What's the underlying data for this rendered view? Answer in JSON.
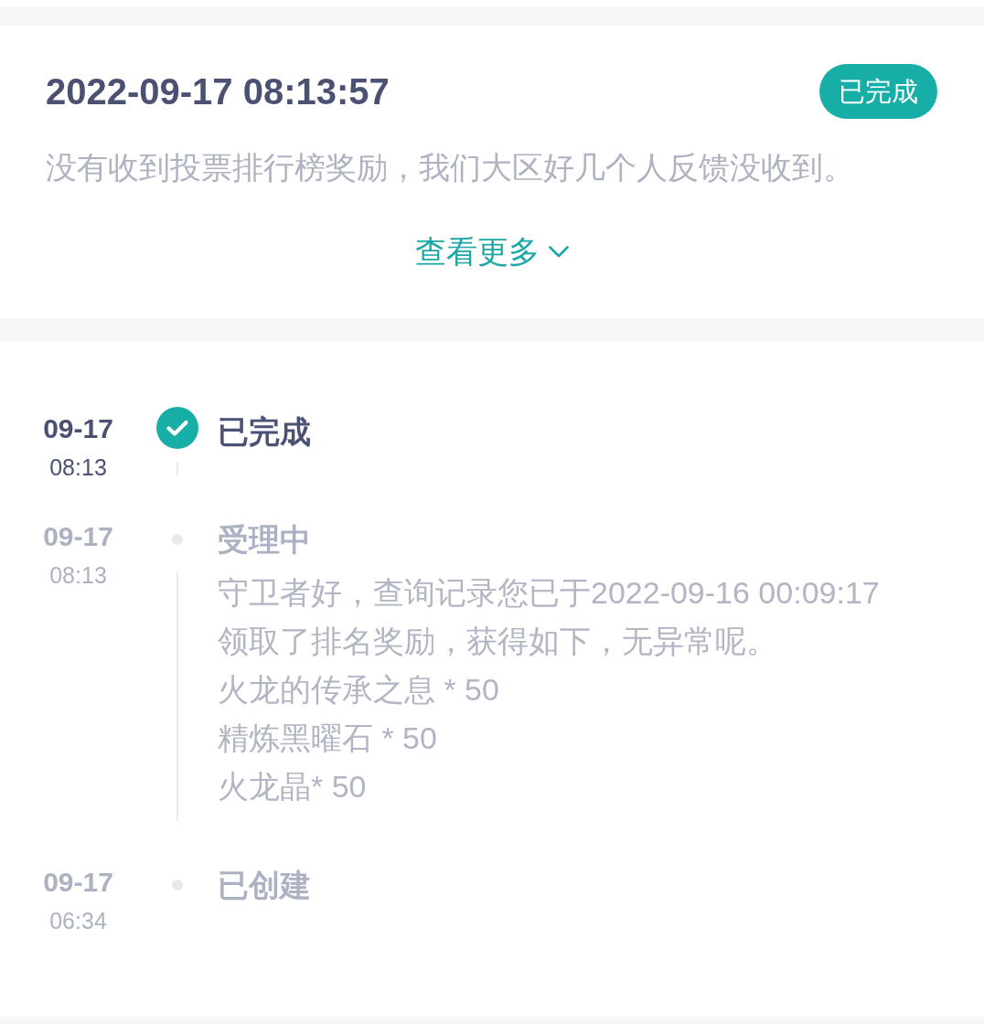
{
  "ticket": {
    "time": "2022-09-17 08:13:57",
    "status": "已完成",
    "description": "没有收到投票排行榜奖励，我们大区好几个人反馈没收到。",
    "more_link": "查看更多"
  },
  "timeline": [
    {
      "date": "09-17",
      "time": "08:13",
      "title": "已完成",
      "active": true
    },
    {
      "date": "09-17",
      "time": "08:13",
      "title": "受理中",
      "active": false,
      "body": [
        "守卫者好，查询记录您已于2022-09-16 00:09:17",
        "领取了排名奖励，获得如下，无异常呢。",
        "火龙的传承之息 * 50",
        "精炼黑曜石 * 50",
        "火龙晶* 50"
      ]
    },
    {
      "date": "09-17",
      "time": "06:34",
      "title": "已创建",
      "active": false
    }
  ]
}
